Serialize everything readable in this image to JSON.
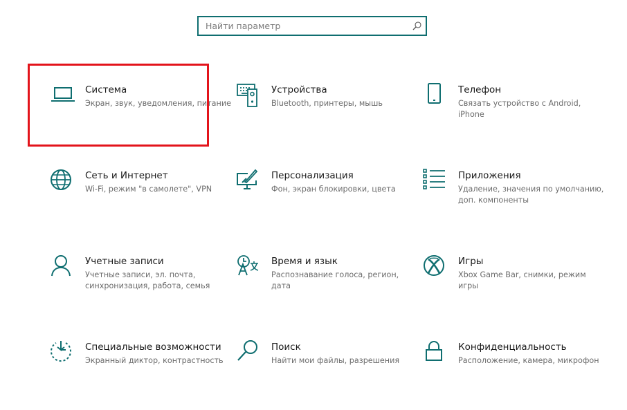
{
  "search": {
    "placeholder": "Найти параметр",
    "icon": "search-icon"
  },
  "accent_color": "#0f6e70",
  "highlight_color": "#e3141b",
  "tiles": [
    {
      "id": "system",
      "title": "Система",
      "desc": "Экран, звук, уведомления, питание",
      "icon": "laptop-icon"
    },
    {
      "id": "devices",
      "title": "Устройства",
      "desc": "Bluetooth, принтеры, мышь",
      "icon": "devices-icon"
    },
    {
      "id": "phone",
      "title": "Телефон",
      "desc": "Связать устройство с Android, iPhone",
      "icon": "phone-icon"
    },
    {
      "id": "network",
      "title": "Сеть и Интернет",
      "desc": "Wi-Fi, режим \"в самолете\", VPN",
      "icon": "globe-icon"
    },
    {
      "id": "personalization",
      "title": "Персонализация",
      "desc": "Фон, экран блокировки, цвета",
      "icon": "personalization-icon"
    },
    {
      "id": "apps",
      "title": "Приложения",
      "desc": "Удаление, значения по умолчанию, доп. компоненты",
      "icon": "apps-list-icon"
    },
    {
      "id": "accounts",
      "title": "Учетные записи",
      "desc": "Учетные записи, эл. почта, синхронизация, работа, семья",
      "icon": "person-icon"
    },
    {
      "id": "time-language",
      "title": "Время и язык",
      "desc": "Распознавание голоса, регион, дата",
      "icon": "time-language-icon"
    },
    {
      "id": "gaming",
      "title": "Игры",
      "desc": "Xbox Game Bar, снимки, режим игры",
      "icon": "xbox-icon"
    },
    {
      "id": "accessibility",
      "title": "Специальные возможности",
      "desc": "Экранный диктор, контрастность",
      "icon": "accessibility-icon"
    },
    {
      "id": "search",
      "title": "Поиск",
      "desc": "Найти мои файлы, разрешения",
      "icon": "search-icon"
    },
    {
      "id": "privacy",
      "title": "Конфиденциальность",
      "desc": "Расположение, камера, микрофон",
      "icon": "lock-icon"
    }
  ],
  "highlighted_tile": "system"
}
